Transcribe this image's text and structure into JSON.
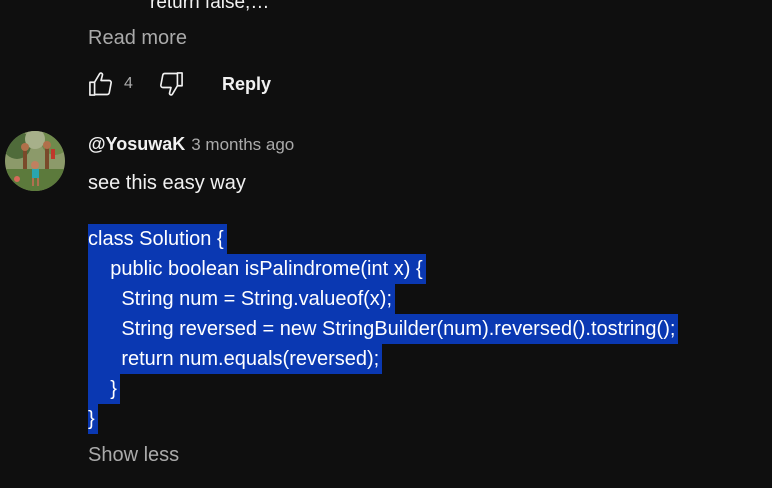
{
  "previous_comment": {
    "truncated_line": "return false;…",
    "read_more_label": "Read more",
    "like_count": "4",
    "reply_label": "Reply"
  },
  "comment": {
    "author": "@YosuwaK",
    "timestamp": "3 months ago",
    "text": "see this easy way",
    "code_lines": [
      "class Solution {",
      "    public boolean isPalindrome(int x) {",
      "      String num = String.valueof(x);",
      "      String reversed = new StringBuilder(num).reversed().tostring();",
      "      return num.equals(reversed);",
      "    }",
      "}"
    ],
    "show_less_label": "Show less"
  },
  "colors": {
    "background": "#0f0f0f",
    "primary_text": "#f1f1f1",
    "secondary_text": "#aaaaaa",
    "selection": "#0a38b2"
  },
  "icons": {
    "like": "thumbs-up-icon",
    "dislike": "thumbs-down-icon"
  }
}
